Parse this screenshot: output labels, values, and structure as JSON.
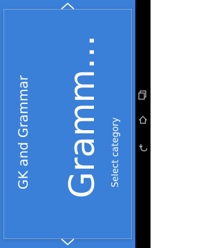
{
  "app": {
    "title": "GK and Grammar",
    "category_title": "Gramm…",
    "subtitle": "Select category",
    "background_color": "#3a7fd8",
    "text_color": "#ffffff"
  },
  "navigation": {
    "previous_icon": "chevron-up-icon",
    "next_icon": "chevron-down-icon"
  },
  "system_nav": {
    "buttons": [
      {
        "name": "recent-apps",
        "icon": "recent-apps-icon"
      },
      {
        "name": "home",
        "icon": "home-icon"
      },
      {
        "name": "back",
        "icon": "back-icon"
      }
    ]
  }
}
